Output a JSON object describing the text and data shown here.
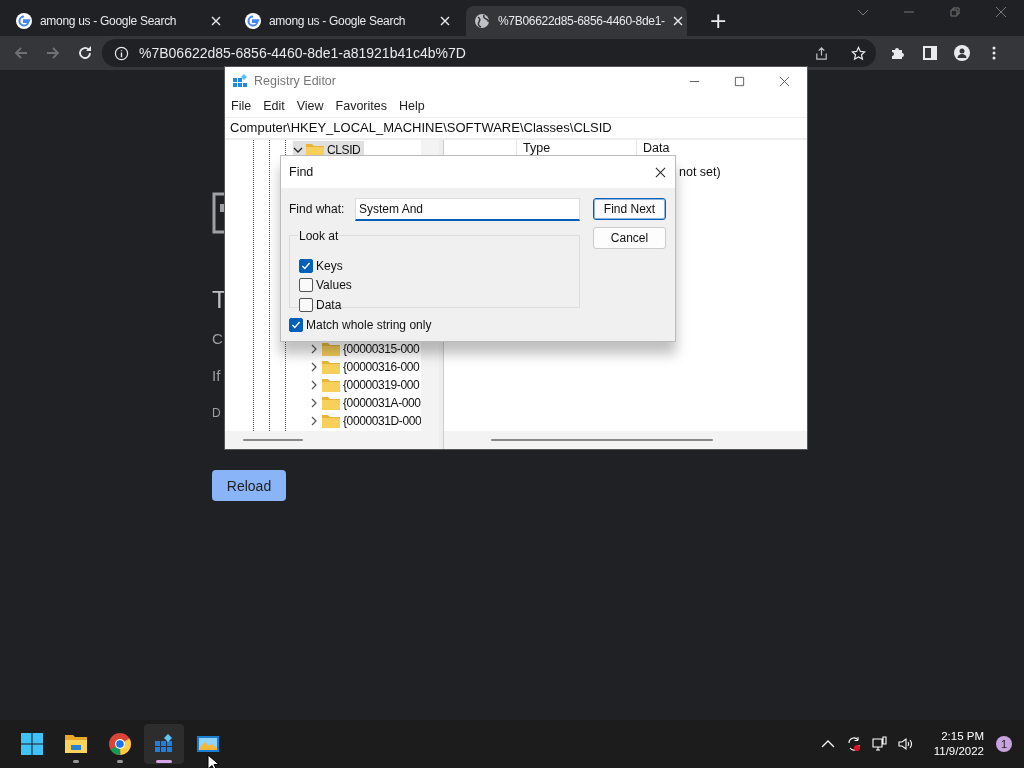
{
  "browser": {
    "tabs": [
      {
        "title": "among us - Google Search",
        "kind": "google",
        "selected": false
      },
      {
        "title": "among us - Google Search",
        "kind": "google",
        "selected": false
      },
      {
        "title": "%7B06622d85-6856-4460-8de1-",
        "kind": "globe",
        "selected": true
      }
    ],
    "new_tab": "+",
    "back_enabled": false,
    "forward_enabled": false,
    "address": "%7B06622d85-6856-4460-8de1-a81921b41c4b%7D"
  },
  "page": {
    "texts": [
      "T",
      "C",
      "If",
      "D"
    ],
    "reload_button": "Reload"
  },
  "regedit": {
    "title": "Registry Editor",
    "menu": [
      "File",
      "Edit",
      "View",
      "Favorites",
      "Help"
    ],
    "path": "Computer\\HKEY_LOCAL_MACHINE\\SOFTWARE\\Classes\\CLSID",
    "tree": [
      {
        "name": "CLSID",
        "expanded": true,
        "selected": true,
        "children": [
          {
            "name": "{00000315-000",
            "expanded": false,
            "selected": false
          },
          {
            "name": "{00000316-000",
            "expanded": false,
            "selected": false
          },
          {
            "name": "{00000319-000",
            "expanded": false,
            "selected": false
          },
          {
            "name": "{0000031A-000",
            "expanded": false,
            "selected": false
          },
          {
            "name": "{0000031D-000",
            "expanded": false,
            "selected": false
          }
        ]
      }
    ],
    "columns": [
      "Type",
      "Data"
    ],
    "values": [
      {
        "data": "not set)"
      }
    ]
  },
  "find": {
    "title": "Find",
    "label": "Find what:",
    "value": "System And",
    "buttons": [
      {
        "label": "Find Next",
        "default": true
      },
      {
        "label": "Cancel",
        "default": false
      }
    ],
    "group": "Look at",
    "options": [
      {
        "label": "Keys",
        "checked": true
      },
      {
        "label": "Values",
        "checked": false
      },
      {
        "label": "Data",
        "checked": false
      }
    ],
    "match": {
      "label": "Match whole string only",
      "checked": true
    }
  },
  "taskbar": {
    "apps": [
      {
        "kind": "start",
        "open": false,
        "selected": false
      },
      {
        "kind": "explorer",
        "open": true,
        "selected": false
      },
      {
        "kind": "chrome",
        "open": true,
        "selected": false
      },
      {
        "kind": "regedit",
        "open": true,
        "selected": true
      },
      {
        "kind": "display",
        "open": false,
        "selected": false
      }
    ],
    "time": "2:15 PM",
    "date": "11/9/2022",
    "notifications": "1"
  }
}
